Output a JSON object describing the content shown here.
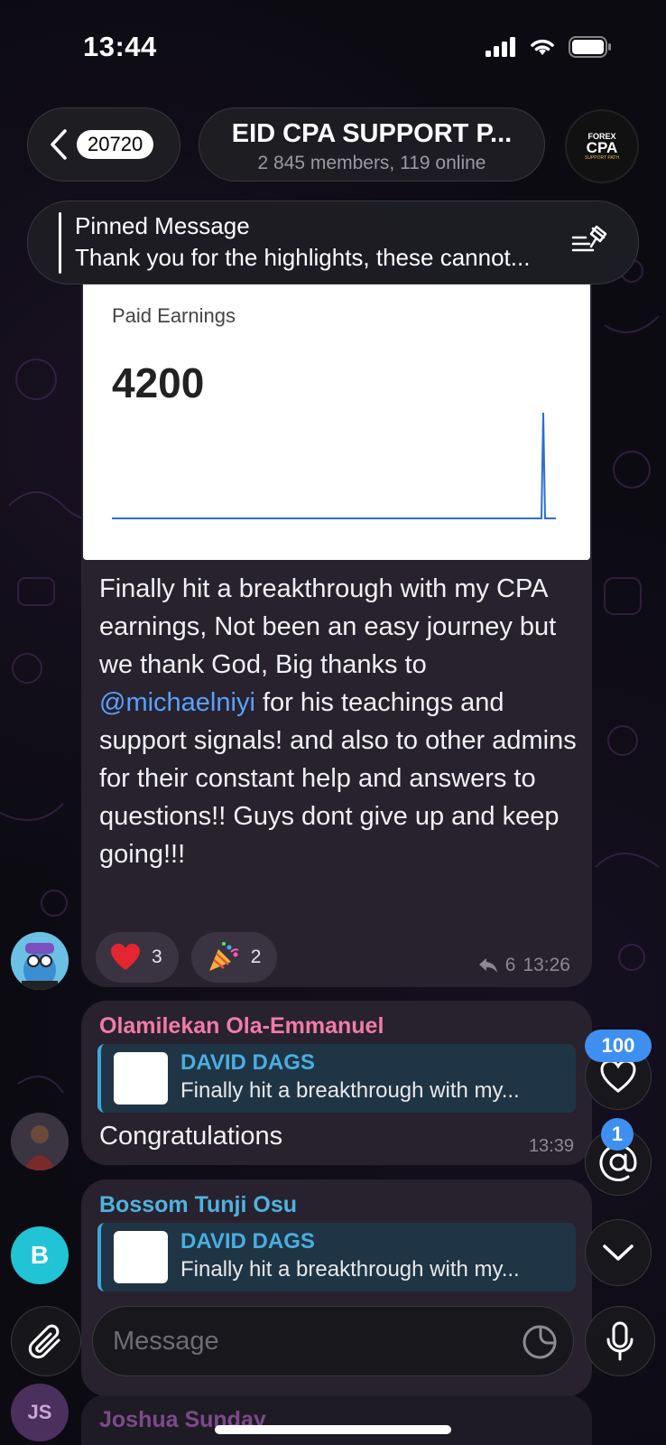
{
  "status_bar": {
    "time": "13:44"
  },
  "header": {
    "back_count": "20720",
    "group_name": "EID CPA SUPPORT P...",
    "group_status": "2 845 members, 119 online",
    "avatar_line1": "FOREX",
    "avatar_line2": "CPA",
    "avatar_line3": "SUPPORT PATH"
  },
  "pinned": {
    "title": "Pinned Message",
    "text": "Thank you for the highlights, these cannot..."
  },
  "main_message": {
    "card_label": "Paid Earnings",
    "card_value": "4200",
    "text_before": "Finally hit a breakthrough with my CPA earnings, Not been an easy journey but we thank God, Big thanks to ",
    "mention": "@michaelniyi",
    "text_after": " for his teachings and support signals! and also to other admins for their constant help and answers to questions!!    Guys dont give up and keep going!!!",
    "reactions": [
      {
        "icon": "heart",
        "count": "3"
      },
      {
        "icon": "party-popper",
        "count": "2"
      }
    ],
    "reply_count": "6",
    "time": "13:26"
  },
  "replies": [
    {
      "sender": "Olamilekan Ola-Emmanuel",
      "sender_color": "#f27ba8",
      "quote_name": "DAVID DAGS",
      "quote_text": "Finally hit a breakthrough with my...",
      "text": "Congratulations",
      "time": "13:39"
    },
    {
      "sender": "Bossom Tunji Osu",
      "sender_color": "#4fb3e0",
      "quote_name": "DAVID DAGS",
      "quote_text": "Finally hit a breakthrough with my...",
      "avatar_initial": "B"
    }
  ],
  "next_message": {
    "sender": "Joshua Sunday",
    "avatar_initials": "JS"
  },
  "side_buttons": {
    "heart_badge": "100",
    "mention_badge": "1"
  },
  "composer": {
    "placeholder": "Message"
  },
  "colors": {
    "accent": "#3f8ff0",
    "bubble": "#27222e",
    "link": "#5aa1ff"
  }
}
